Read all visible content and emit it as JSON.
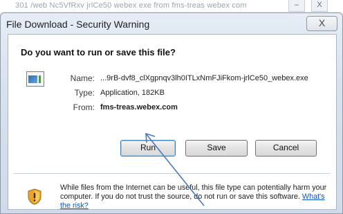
{
  "background_window": {
    "text": "301 /web Nc5VfRxv jrlCe50 webex exe from fms-treas webex com",
    "minimize": "–",
    "close": "X"
  },
  "dialog": {
    "title": "File Download - Security Warning",
    "close_glyph": "X",
    "question": "Do you want to run or save this file?",
    "file": {
      "name_label": "Name:",
      "name_value": "...9rB-dvf8_clXgpnqv3lh0ITLxNmFJiFkom-jrlCe50_webex.exe",
      "type_label": "Type:",
      "type_value": "Application, 182KB",
      "from_label": "From:",
      "from_value": "fms-treas.webex.com",
      "icon": "application-icon"
    },
    "buttons": {
      "run": "Run",
      "save": "Save",
      "cancel": "Cancel"
    },
    "warning": {
      "icon": "shield-warning-icon",
      "text": "While files from the Internet can be useful, this file type can potentially harm your computer. If you do not trust the source, do not run or save this software. ",
      "link": "What's the risk?"
    }
  },
  "annotation": {
    "arrow_color": "#4a78c2"
  }
}
